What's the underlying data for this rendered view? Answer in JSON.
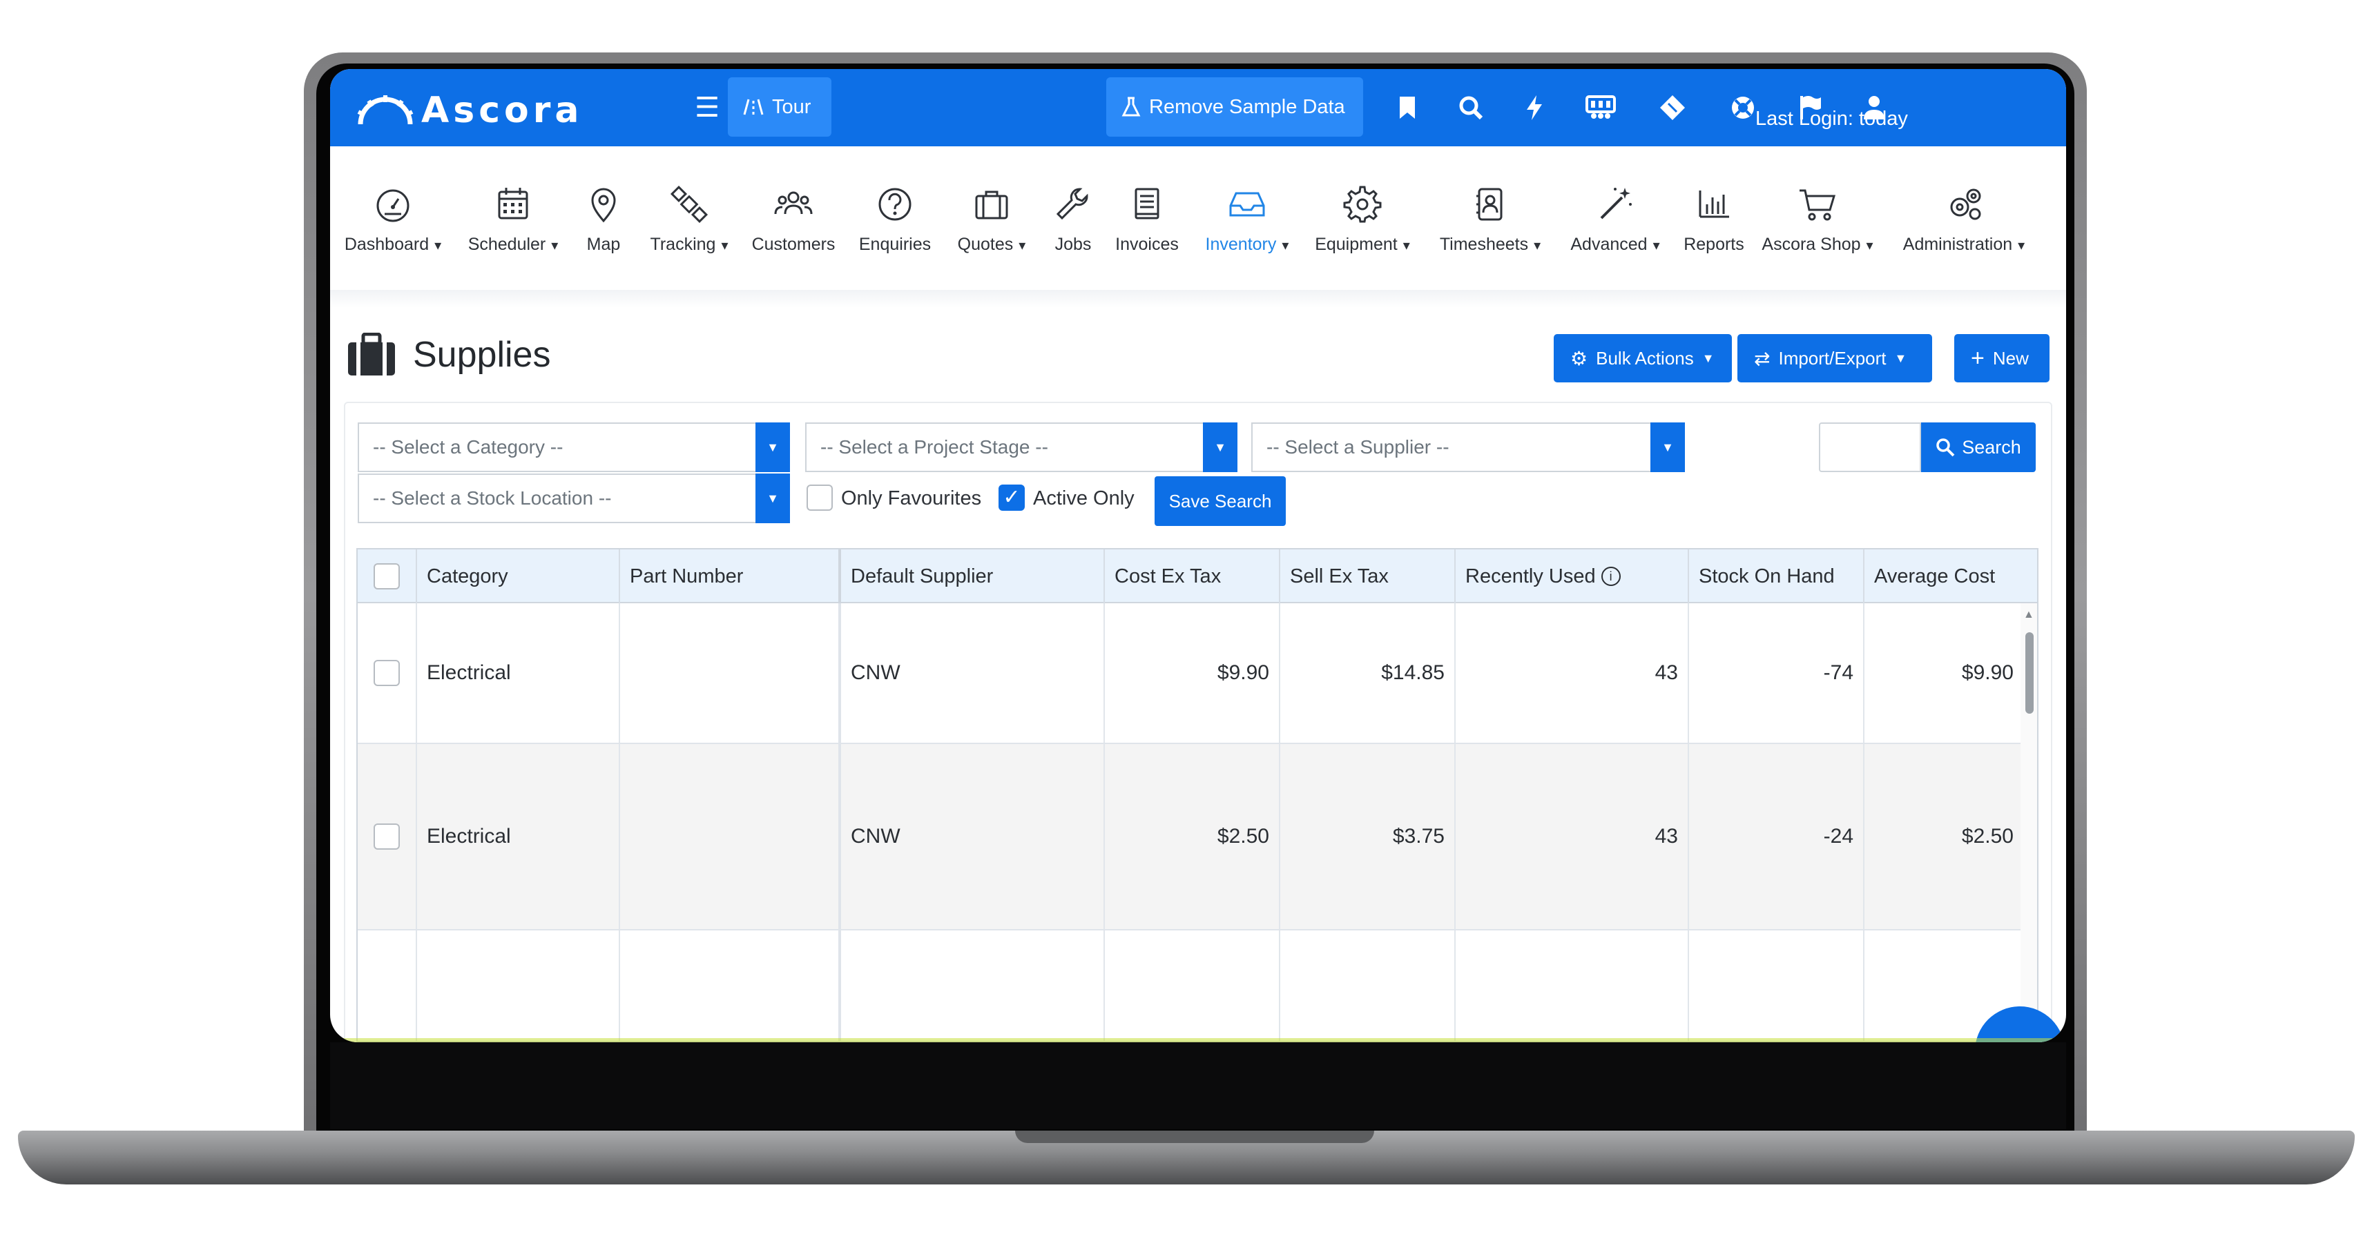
{
  "app": {
    "brand": "Ascora"
  },
  "topbar": {
    "tour_label": "Tour",
    "remove_sample_label": "Remove Sample Data",
    "last_login": "Last Login: today"
  },
  "modules": [
    {
      "label": "Dashboard",
      "caret": true,
      "icon": "speedometer-icon"
    },
    {
      "label": "Scheduler",
      "caret": true,
      "icon": "calendar-icon"
    },
    {
      "label": "Map",
      "caret": false,
      "icon": "map-pin-icon"
    },
    {
      "label": "Tracking",
      "caret": true,
      "icon": "satellite-icon"
    },
    {
      "label": "Customers",
      "caret": false,
      "icon": "people-icon"
    },
    {
      "label": "Enquiries",
      "caret": false,
      "icon": "question-icon"
    },
    {
      "label": "Quotes",
      "caret": true,
      "icon": "briefcase-icon"
    },
    {
      "label": "Jobs",
      "caret": false,
      "icon": "wrench-icon"
    },
    {
      "label": "Invoices",
      "caret": false,
      "icon": "book-icon"
    },
    {
      "label": "Inventory",
      "caret": true,
      "icon": "inbox-icon",
      "active": true
    },
    {
      "label": "Equipment",
      "caret": true,
      "icon": "gear-icon"
    },
    {
      "label": "Timesheets",
      "caret": true,
      "icon": "contact-card-icon"
    },
    {
      "label": "Advanced",
      "caret": true,
      "icon": "magic-wand-icon"
    },
    {
      "label": "Reports",
      "caret": false,
      "icon": "bar-chart-icon"
    },
    {
      "label": "Ascora Shop",
      "caret": true,
      "icon": "cart-icon"
    },
    {
      "label": "Administration",
      "caret": true,
      "icon": "gears-icon"
    }
  ],
  "page": {
    "title": "Supplies",
    "bulk_actions": "Bulk Actions",
    "import_export": "Import/Export",
    "new": "New"
  },
  "filters": {
    "category": "-- Select a Category --",
    "project_stage": "-- Select a Project Stage --",
    "supplier": "-- Select a Supplier --",
    "stock_location": "-- Select a Stock Location --",
    "only_favourites": "Only Favourites",
    "active_only": "Active Only",
    "active_only_checked": true,
    "only_favourites_checked": false,
    "save_search": "Save Search",
    "search": "Search",
    "search_value": ""
  },
  "table": {
    "columns": [
      "Category",
      "Part Number",
      "Default Supplier",
      "Cost Ex Tax",
      "Sell Ex Tax",
      "Recently Used",
      "Stock On Hand",
      "Average Cost"
    ],
    "rows": [
      {
        "category": "Electrical",
        "part_number": "",
        "supplier": "CNW",
        "cost": "$9.90",
        "sell": "$14.85",
        "recent": "43",
        "stock": "-74",
        "avg": "$9.90"
      },
      {
        "category": "Electrical",
        "part_number": "",
        "supplier": "CNW",
        "cost": "$2.50",
        "sell": "$3.75",
        "recent": "43",
        "stock": "-24",
        "avg": "$2.50"
      },
      {
        "category": "",
        "part_number": "",
        "supplier": "",
        "cost": "",
        "sell": "",
        "recent": "",
        "stock": "",
        "avg": ""
      }
    ]
  }
}
